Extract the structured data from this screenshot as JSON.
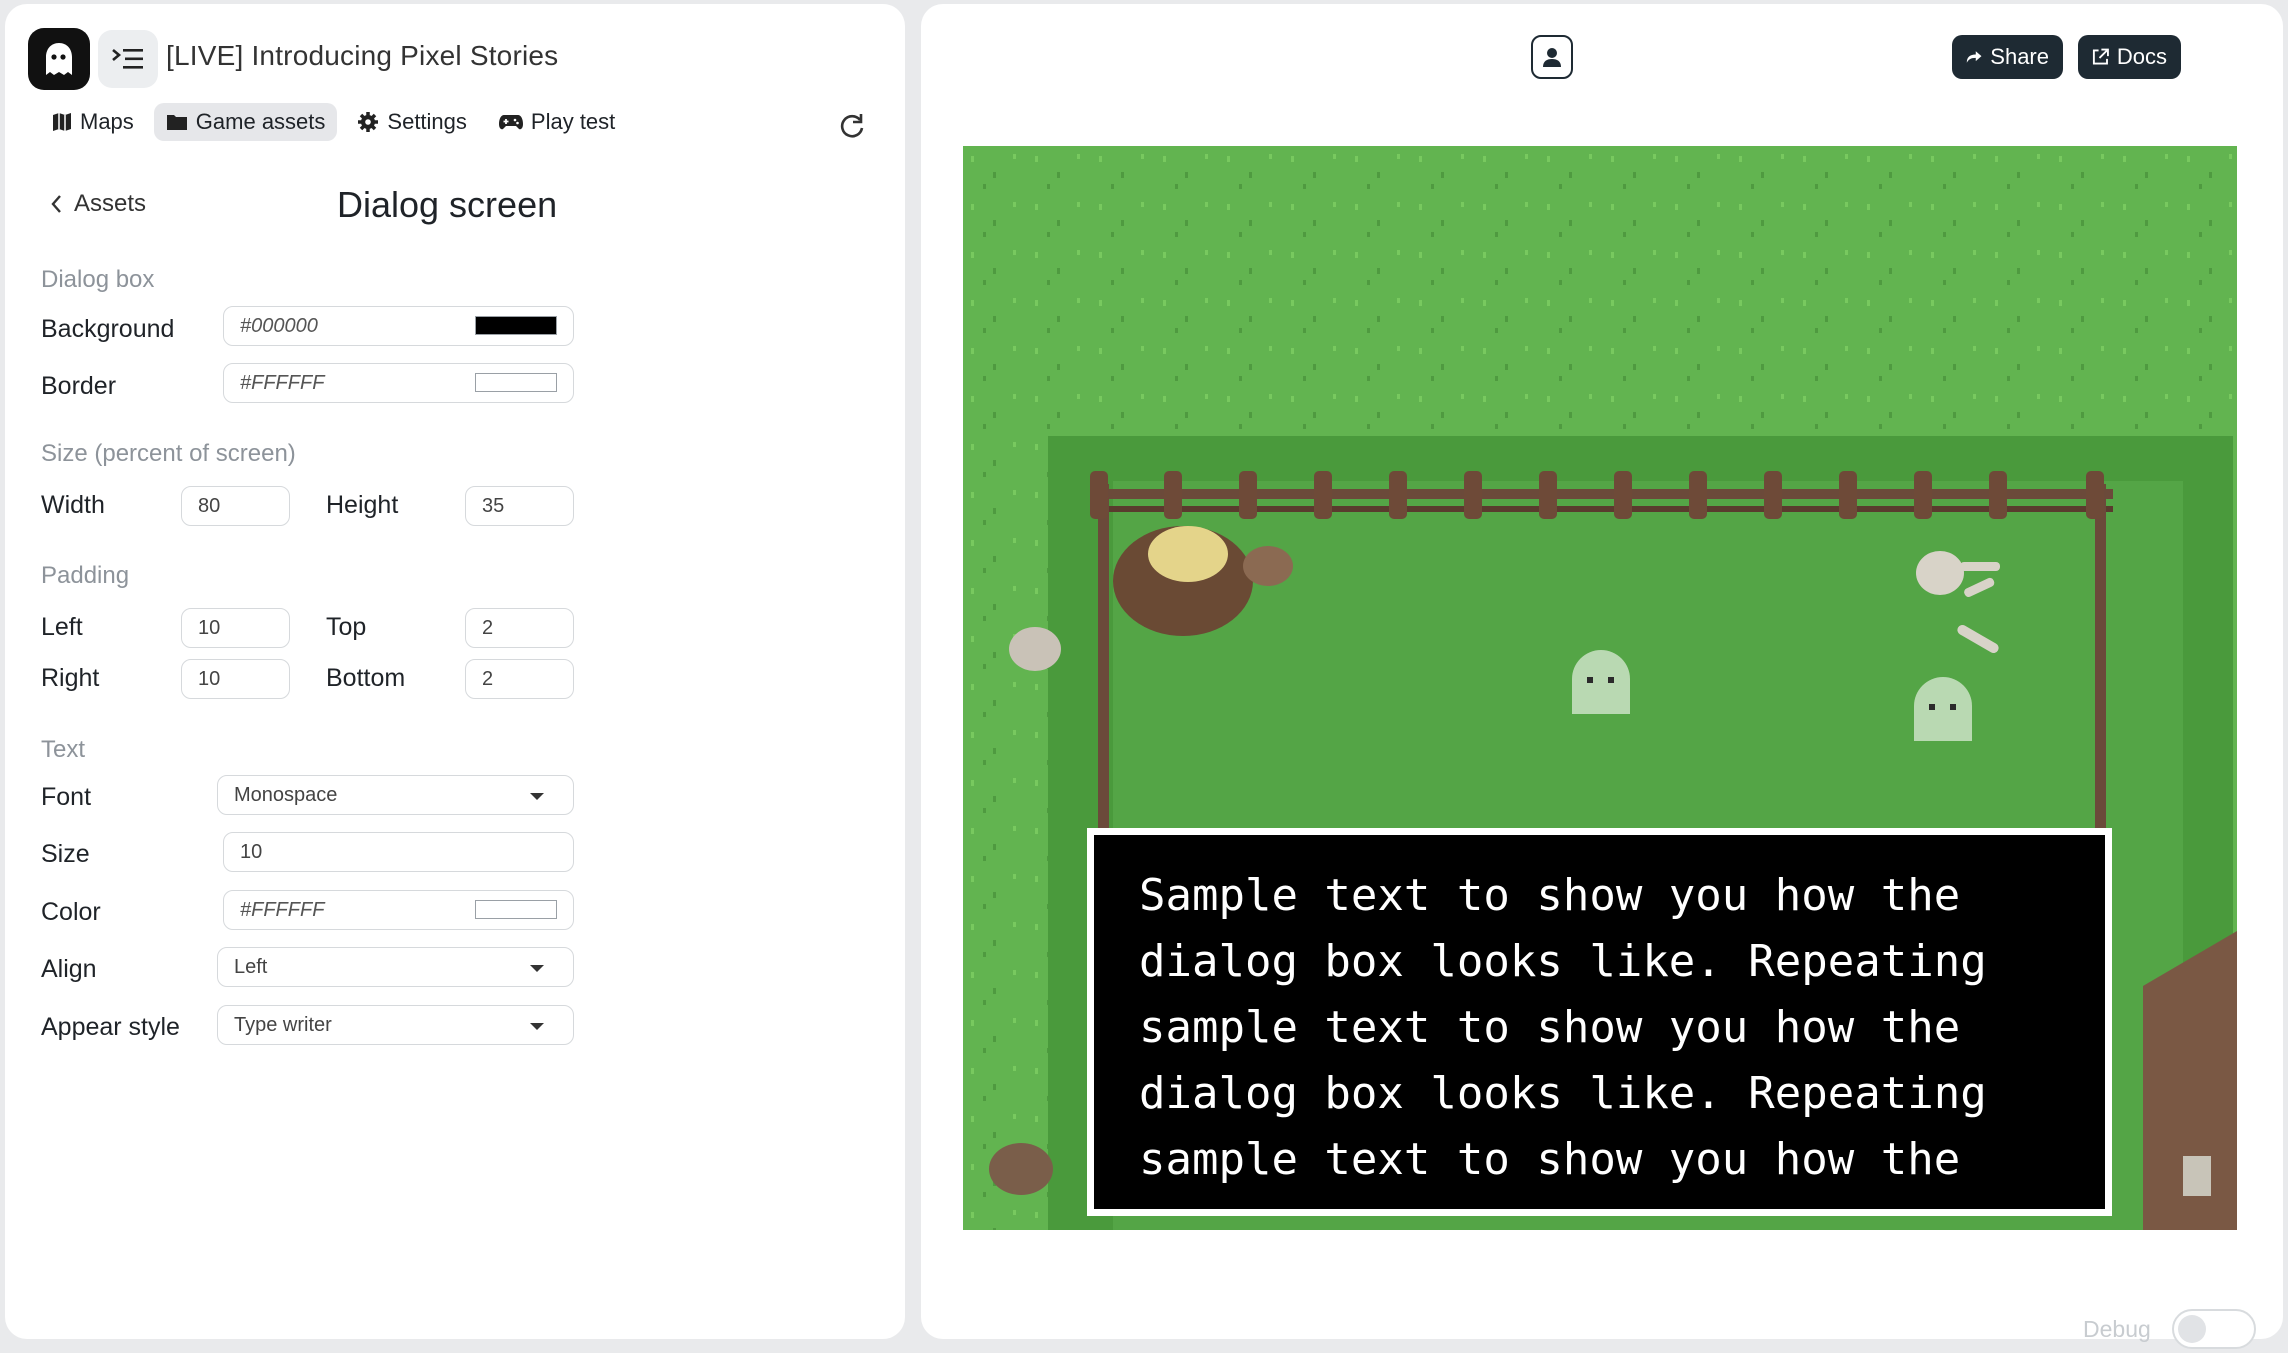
{
  "header": {
    "project_title": "[LIVE] Introducing Pixel Stories",
    "logo_icon": "ghost-icon",
    "menu_icon": "collapse-menu-icon"
  },
  "nav": {
    "items": [
      {
        "label": "Maps",
        "icon": "map-icon"
      },
      {
        "label": "Game assets",
        "icon": "folder-icon",
        "active": true
      },
      {
        "label": "Settings",
        "icon": "gear-icon"
      },
      {
        "label": "Play test",
        "icon": "gamepad-icon"
      }
    ],
    "refresh_icon": "refresh-icon"
  },
  "editor": {
    "back_label": "Assets",
    "title": "Dialog screen",
    "dialog_box": {
      "section": "Dialog box",
      "background_label": "Background",
      "background_value": "#000000",
      "border_label": "Border",
      "border_value": "#FFFFFF"
    },
    "size": {
      "section": "Size (percent of screen)",
      "width_label": "Width",
      "width_value": "80",
      "height_label": "Height",
      "height_value": "35"
    },
    "padding": {
      "section": "Padding",
      "left_label": "Left",
      "left_value": "10",
      "top_label": "Top",
      "top_value": "2",
      "right_label": "Right",
      "right_value": "10",
      "bottom_label": "Bottom",
      "bottom_value": "2"
    },
    "text": {
      "section": "Text",
      "font_label": "Font",
      "font_value": "Monospace",
      "size_label": "Size",
      "size_value": "10",
      "color_label": "Color",
      "color_value": "#FFFFFF",
      "align_label": "Align",
      "align_value": "Left",
      "appear_label": "Appear style",
      "appear_value": "Type writer"
    }
  },
  "preview": {
    "share_label": "Share",
    "docs_label": "Docs",
    "dialog_text": "Sample text to show you how the\ndialog box looks like. Repeating\nsample text to show you how the\ndialog box looks like. Repeating\nsample text to show you how the",
    "debug_label": "Debug",
    "colors": {
      "grass": "#62b450",
      "dialog_bg": "#000000",
      "dialog_border": "#FFFFFF"
    }
  }
}
